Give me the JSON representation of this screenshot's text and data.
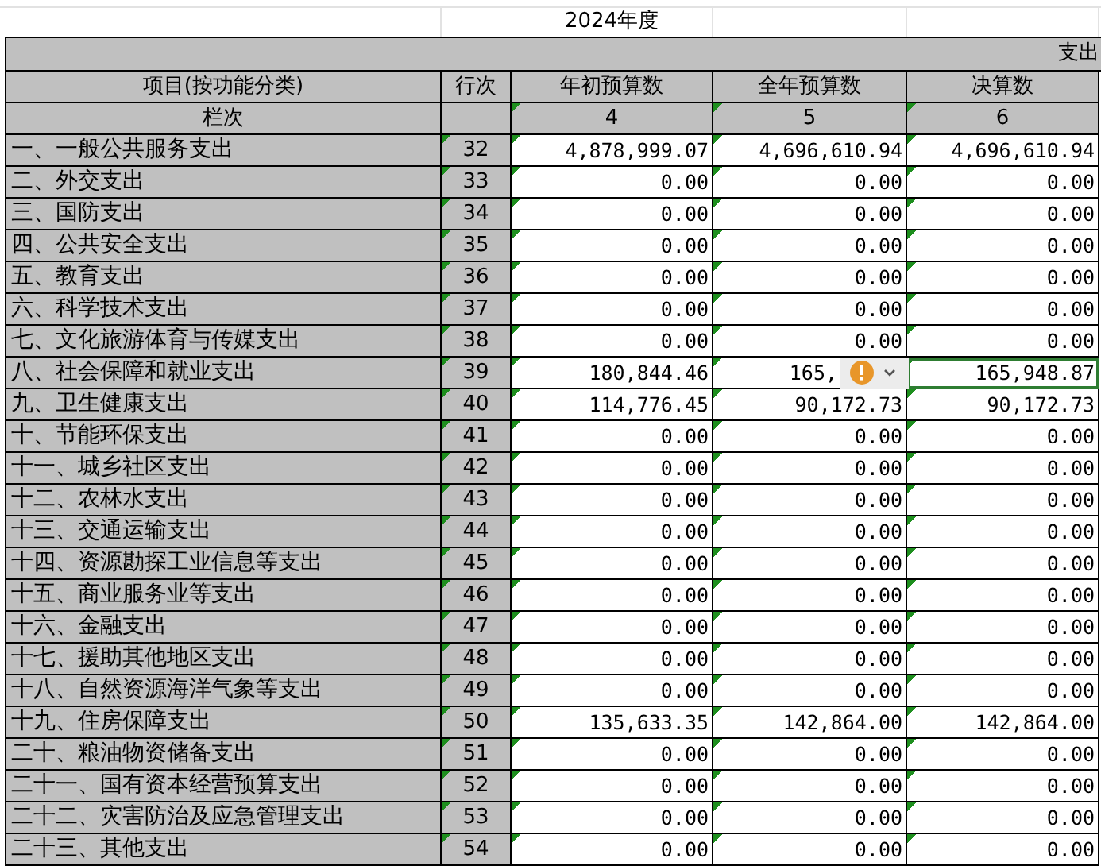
{
  "title": "2024年度",
  "unit_header": "支出",
  "columns": [
    "项目(按功能分类)",
    "行次",
    "年初预算数",
    "全年预算数",
    "决算数"
  ],
  "index_row": {
    "label": "栏次",
    "numbers": [
      "4",
      "5",
      "6"
    ]
  },
  "rows": [
    {
      "name": "一、一般公共服务支出",
      "line": "32",
      "values": [
        "4,878,999.07",
        "4,696,610.94",
        "4,696,610.94"
      ],
      "warning": false,
      "selected": false
    },
    {
      "name": "二、外交支出",
      "line": "33",
      "values": [
        "0.00",
        "0.00",
        "0.00"
      ],
      "warning": false,
      "selected": false
    },
    {
      "name": "三、国防支出",
      "line": "34",
      "values": [
        "0.00",
        "0.00",
        "0.00"
      ],
      "warning": false,
      "selected": false
    },
    {
      "name": "四、公共安全支出",
      "line": "35",
      "values": [
        "0.00",
        "0.00",
        "0.00"
      ],
      "warning": false,
      "selected": false
    },
    {
      "name": "五、教育支出",
      "line": "36",
      "values": [
        "0.00",
        "0.00",
        "0.00"
      ],
      "warning": false,
      "selected": false
    },
    {
      "name": "六、科学技术支出",
      "line": "37",
      "values": [
        "0.00",
        "0.00",
        "0.00"
      ],
      "warning": false,
      "selected": false
    },
    {
      "name": "七、文化旅游体育与传媒支出",
      "line": "38",
      "values": [
        "0.00",
        "0.00",
        "0.00"
      ],
      "warning": false,
      "selected": false
    },
    {
      "name": "八、社会保障和就业支出",
      "line": "39",
      "values": [
        "180,844.46",
        "165,",
        "165,948.87"
      ],
      "warning": true,
      "selected": true
    },
    {
      "name": "九、卫生健康支出",
      "line": "40",
      "values": [
        "114,776.45",
        "90,172.73",
        "90,172.73"
      ],
      "warning": false,
      "selected": false
    },
    {
      "name": "十、节能环保支出",
      "line": "41",
      "values": [
        "0.00",
        "0.00",
        "0.00"
      ],
      "warning": false,
      "selected": false
    },
    {
      "name": "十一、城乡社区支出",
      "line": "42",
      "values": [
        "0.00",
        "0.00",
        "0.00"
      ],
      "warning": false,
      "selected": false
    },
    {
      "name": "十二、农林水支出",
      "line": "43",
      "values": [
        "0.00",
        "0.00",
        "0.00"
      ],
      "warning": false,
      "selected": false
    },
    {
      "name": "十三、交通运输支出",
      "line": "44",
      "values": [
        "0.00",
        "0.00",
        "0.00"
      ],
      "warning": false,
      "selected": false
    },
    {
      "name": "十四、资源勘探工业信息等支出",
      "line": "45",
      "values": [
        "0.00",
        "0.00",
        "0.00"
      ],
      "warning": false,
      "selected": false
    },
    {
      "name": "十五、商业服务业等支出",
      "line": "46",
      "values": [
        "0.00",
        "0.00",
        "0.00"
      ],
      "warning": false,
      "selected": false
    },
    {
      "name": "十六、金融支出",
      "line": "47",
      "values": [
        "0.00",
        "0.00",
        "0.00"
      ],
      "warning": false,
      "selected": false
    },
    {
      "name": "十七、援助其他地区支出",
      "line": "48",
      "values": [
        "0.00",
        "0.00",
        "0.00"
      ],
      "warning": false,
      "selected": false
    },
    {
      "name": "十八、自然资源海洋气象等支出",
      "line": "49",
      "values": [
        "0.00",
        "0.00",
        "0.00"
      ],
      "warning": false,
      "selected": false
    },
    {
      "name": "十九、住房保障支出",
      "line": "50",
      "values": [
        "135,633.35",
        "142,864.00",
        "142,864.00"
      ],
      "warning": false,
      "selected": false
    },
    {
      "name": "二十、粮油物资储备支出",
      "line": "51",
      "values": [
        "0.00",
        "0.00",
        "0.00"
      ],
      "warning": false,
      "selected": false
    },
    {
      "name": "二十一、国有资本经营预算支出",
      "line": "52",
      "values": [
        "0.00",
        "0.00",
        "0.00"
      ],
      "warning": false,
      "selected": false
    },
    {
      "name": "二十二、灾害防治及应急管理支出",
      "line": "53",
      "values": [
        "0.00",
        "0.00",
        "0.00"
      ],
      "warning": false,
      "selected": false
    },
    {
      "name": "二十三、其他支出",
      "line": "54",
      "values": [
        "0.00",
        "0.00",
        "0.00"
      ],
      "warning": false,
      "selected": false
    }
  ]
}
